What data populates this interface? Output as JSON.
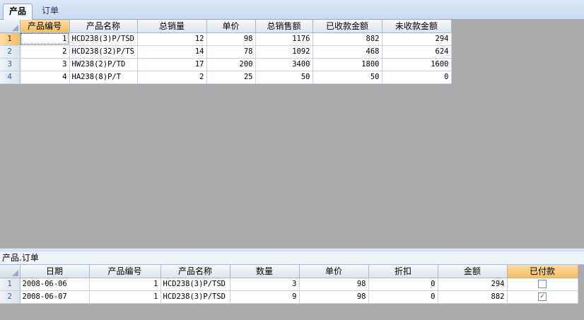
{
  "tabs": [
    {
      "label": "产品"
    },
    {
      "label": "订单"
    }
  ],
  "products": {
    "columns": [
      "产品编号",
      "产品名称",
      "总销量",
      "单价",
      "总销售额",
      "已收款金额",
      "未收款金额"
    ],
    "rows": [
      {
        "num": "1",
        "cells": [
          "1",
          "HCD238(3)P/TSD",
          "12",
          "98",
          "1176",
          "882",
          "294"
        ]
      },
      {
        "num": "2",
        "cells": [
          "2",
          "HCD238(32)P/TS",
          "14",
          "78",
          "1092",
          "468",
          "624"
        ]
      },
      {
        "num": "3",
        "cells": [
          "3",
          "HW238(2)P/TD",
          "17",
          "200",
          "3400",
          "1800",
          "1600"
        ]
      },
      {
        "num": "4",
        "cells": [
          "4",
          "HA238(8)P/T",
          "2",
          "25",
          "50",
          "50",
          "0"
        ]
      }
    ]
  },
  "detail": {
    "caption": "产品.订单",
    "columns": [
      "日期",
      "产品编号",
      "产品名称",
      "数量",
      "单价",
      "折扣",
      "金额",
      "已付款"
    ],
    "rows": [
      {
        "num": "1",
        "cells": [
          "2008-06-06",
          "1",
          "HCD238(3)P/TSD",
          "3",
          "98",
          "0",
          "294"
        ],
        "paid": false
      },
      {
        "num": "2",
        "cells": [
          "2008-06-07",
          "1",
          "HCD238(3)P/TSD",
          "9",
          "98",
          "0",
          "882"
        ],
        "paid": true
      }
    ]
  }
}
